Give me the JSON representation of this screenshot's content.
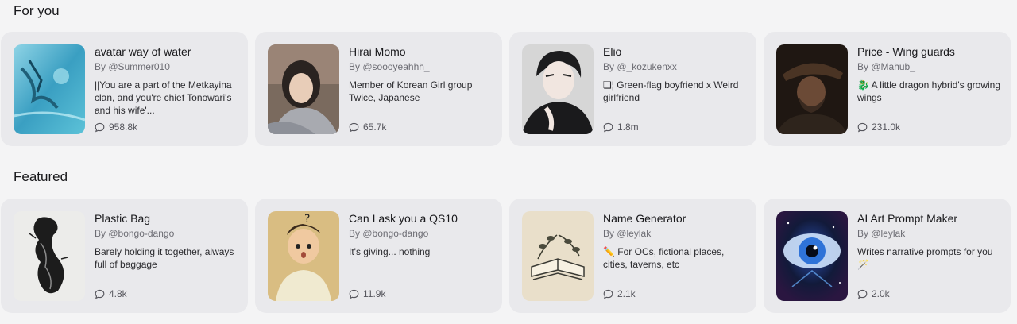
{
  "sections": [
    {
      "title": "For you",
      "cards": [
        {
          "name": "avatar way of water",
          "author": "By @Summer010",
          "description": "||You are a part of the Metkayina clan, and you're chief Tonowari's and his wife'...",
          "count": "958.8k",
          "image": "underwater-diver-art"
        },
        {
          "name": "Hirai Momo",
          "author": "By @soooyeahhh_",
          "description": "Member of Korean Girl group Twice, Japanese",
          "count": "65.7k",
          "image": "girl-in-sweater-photo"
        },
        {
          "name": "Elio",
          "author": "By @_kozukenxx",
          "description": "❏¦ Green-flag boyfriend x Weird girlfriend",
          "count": "1.8m",
          "image": "anime-man-portrait"
        },
        {
          "name": "Price - Wing guards",
          "author": "By @Mahub_",
          "description": "🐉 A little dragon hybrid's growing wings",
          "count": "231.0k",
          "image": "soldier-in-hat-portrait"
        }
      ]
    },
    {
      "title": "Featured",
      "cards": [
        {
          "name": "Plastic Bag",
          "author": "By @bongo-dango",
          "description": "Barely holding it together, always full of baggage",
          "count": "4.8k",
          "image": "ink-plastic-bag"
        },
        {
          "name": "Can I ask you a QS10",
          "author": "By @bongo-dango",
          "description": "It's giving... nothing",
          "count": "11.9k",
          "image": "confused-boy-illustration"
        },
        {
          "name": "Name Generator",
          "author": "By @leylak",
          "description": "✏️ For OCs, fictional places, cities, taverns, etc",
          "count": "2.1k",
          "image": "open-book-with-leaves"
        },
        {
          "name": "AI Art Prompt Maker",
          "author": "By @leylak",
          "description": "Writes narrative prompts for you 🪄",
          "count": "2.0k",
          "image": "cosmic-eye-art"
        }
      ]
    }
  ]
}
